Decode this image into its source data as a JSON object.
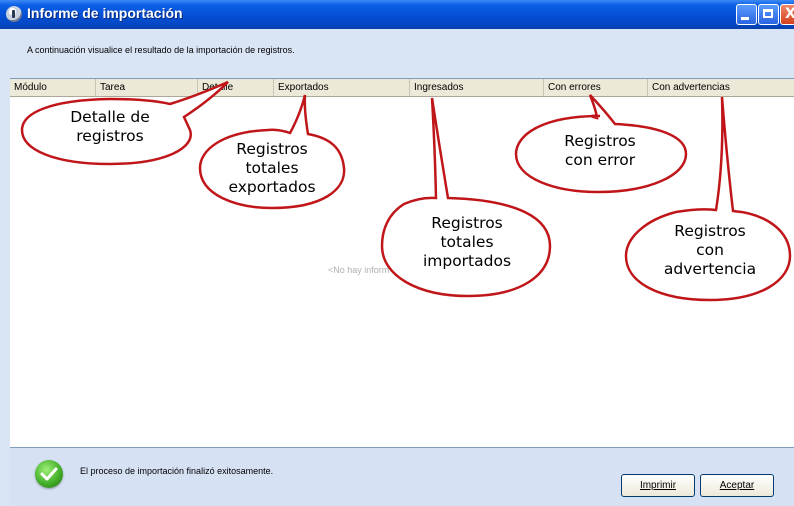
{
  "window": {
    "title": "Informe de importación",
    "controls": [
      "minimize",
      "maximize",
      "close"
    ],
    "close_glyph": "X"
  },
  "subtitle": "A continuación visualice el  resultado de la importación de registros.",
  "grid": {
    "columns": [
      "Módulo",
      "Tarea",
      "Detalle",
      "Exportados",
      "Ingresados",
      "Con errores",
      "Con advertencias"
    ],
    "empty_text": "<No hay inform"
  },
  "status": {
    "icon": "check-icon",
    "message": "El proceso de importación finalizó exitosamente."
  },
  "buttons": {
    "print": "Imprimir",
    "accept": "Aceptar"
  },
  "callouts": [
    {
      "lines": [
        "Detalle de",
        "registros"
      ]
    },
    {
      "lines": [
        "Registros",
        "totales",
        "exportados"
      ]
    },
    {
      "lines": [
        "Registros",
        "con error"
      ]
    },
    {
      "lines": [
        "Registros",
        "totales",
        "importados"
      ]
    },
    {
      "lines": [
        "Registros",
        "con",
        "advertencia"
      ]
    }
  ],
  "colors": {
    "titlebar": "#0550d6",
    "window_bg": "#d9e4f5",
    "callout_border": "#c0161a",
    "success": "#44b02a"
  }
}
